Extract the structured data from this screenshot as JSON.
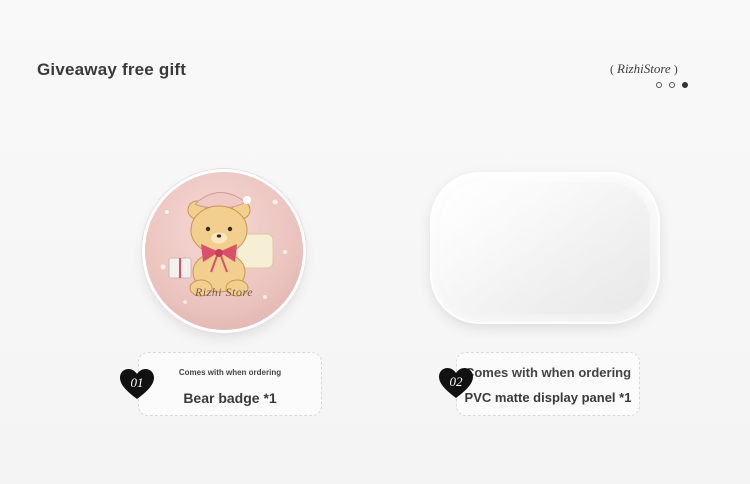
{
  "header": {
    "title": "Giveaway free gift",
    "brand": "RizhiStore",
    "brand_open": "(",
    "brand_close": ")",
    "pager": {
      "count": 3,
      "active_index": 3
    }
  },
  "items": [
    {
      "number": "01",
      "subtitle": "Comes with when ordering",
      "name": "Bear badge *1",
      "image_text": "Rizhi Store",
      "image": "bear-badge"
    },
    {
      "number": "02",
      "subtitle": "Comes with when ordering",
      "name": "PVC matte display panel *1",
      "image": "pvc-matte-panel"
    }
  ],
  "colors": {
    "background": "#f6f6f6",
    "title": "#3a3a3a",
    "heart": "#111111",
    "badge_pink": "#ebc3be",
    "bear": "#f2cf8e",
    "bow": "#d9506a"
  }
}
